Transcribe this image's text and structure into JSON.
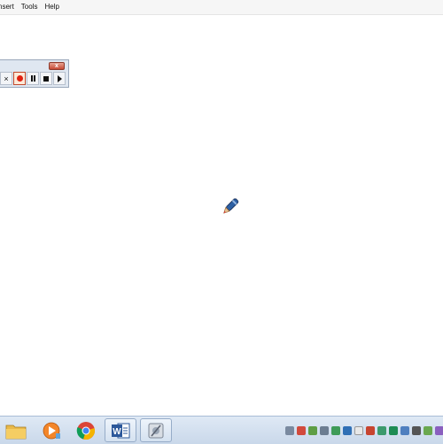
{
  "menu": {
    "items": [
      {
        "label": "nsert"
      },
      {
        "label": "Tools"
      },
      {
        "label": "Help"
      }
    ]
  },
  "recorder": {
    "close_label": "x",
    "cancel_label": "×"
  },
  "taskbar": {
    "apps": [
      {
        "name": "file-explorer"
      },
      {
        "name": "media-player"
      },
      {
        "name": "chrome"
      },
      {
        "name": "word"
      },
      {
        "name": "screen-recorder"
      }
    ],
    "tray_icons": [
      "tray-1",
      "tray-2",
      "tray-3",
      "tray-4",
      "tray-5",
      "tray-6",
      "tray-7",
      "tray-8",
      "tray-9",
      "tray-10",
      "tray-11",
      "tray-12",
      "tray-13",
      "tray-14",
      "tray-15"
    ]
  },
  "colors": {
    "accent": "#2b579a",
    "record": "#e02010"
  }
}
